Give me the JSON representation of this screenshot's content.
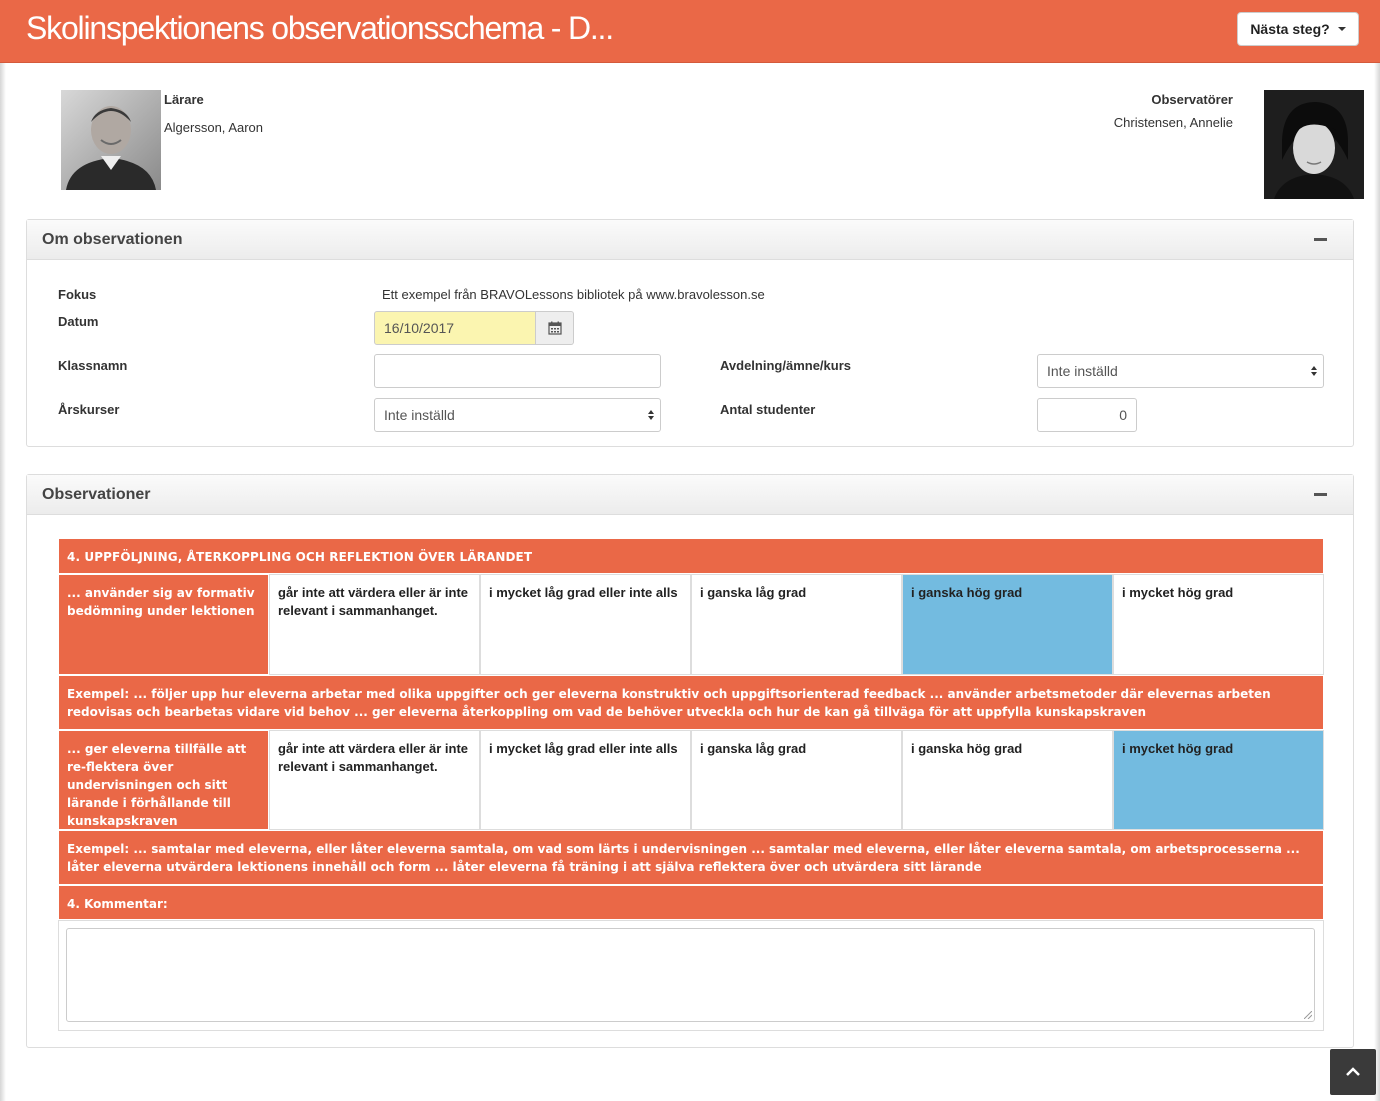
{
  "header": {
    "title": "Skolinspektionens observationsschema - D...",
    "next_button": "Nästa steg?"
  },
  "teacher": {
    "label": "Lärare",
    "name": "Algersson, Aaron"
  },
  "observers": {
    "label": "Observatörer",
    "name": "Christensen, Annelie"
  },
  "about": {
    "title": "Om observationen",
    "fokus_label": "Fokus",
    "fokus_value": "Ett exempel från BRAVOLessons bibliotek på www.bravolesson.se",
    "datum_label": "Datum",
    "datum_value": "16/10/2017",
    "klassnamn_label": "Klassnamn",
    "klassnamn_value": "",
    "avdelning_label": "Avdelning/ämne/kurs",
    "avdelning_value": "Inte inställd",
    "arskurser_label": "Årskurser",
    "arskurser_value": "Inte inställd",
    "antal_label": "Antal studenter",
    "antal_value": "0"
  },
  "observations": {
    "title": "Observationer",
    "section_title": "4. UPPFÖLJNING, ÅTERKOPPLING OCH REFLEKTION ÖVER LÄRANDET",
    "rows": [
      {
        "criterion": "... använder sig av formativ bedömning under lektionen",
        "options": [
          "går inte att värdera eller är inte relevant i sammanhanget.",
          "i mycket låg grad eller inte alls",
          "i ganska låg grad",
          "i ganska hög grad",
          "i mycket hög grad"
        ],
        "selected_index": 3,
        "example": "Exempel: ... följer upp hur eleverna arbetar med olika uppgifter och ger eleverna konstruktiv och uppgiftsorienterad feedback ... använder arbetsmetoder där elevernas arbeten redovisas och bearbetas vidare vid behov ... ger eleverna återkoppling om vad de behöver utveckla och hur de kan gå tillväga för att uppfylla kunskapskraven"
      },
      {
        "criterion": "... ger eleverna tillfälle att re-flektera över undervisningen och sitt lärande i förhållande till kunskapskraven",
        "options": [
          "går inte att värdera eller är inte relevant i sammanhanget.",
          "i mycket låg grad eller inte alls",
          "i ganska låg grad",
          "i ganska hög grad",
          "i mycket hög grad"
        ],
        "selected_index": 4,
        "example": "Exempel: ... samtalar med eleverna, eller låter eleverna samtala, om vad som lärts i undervisningen ... samtalar med eleverna, eller låter eleverna samtala, om arbetsprocesserna ... låter eleverna utvärdera lektionens innehåll och form ... låter eleverna få träning i att själva reflektera över och utvärdera sitt lärande"
      }
    ],
    "comment_label": "4. Kommentar:",
    "comment_value": ""
  },
  "colors": {
    "accent": "#ea6847",
    "selected": "#73bbe0",
    "date_highlight": "#fbf5b0"
  }
}
